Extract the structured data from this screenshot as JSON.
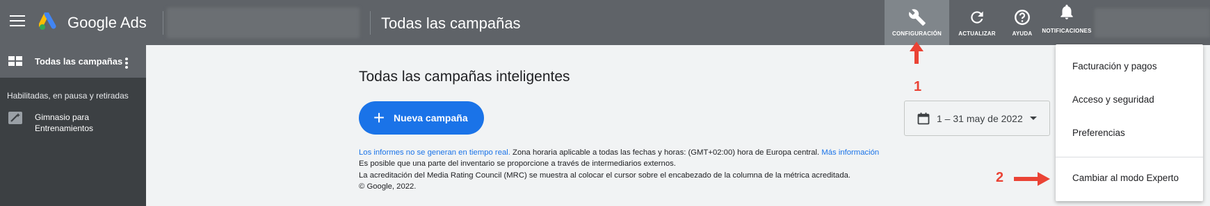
{
  "header": {
    "product_name": "Google Ads",
    "page_title": "Todas las campañas",
    "tools": {
      "configuracion": "CONFIGURACIÓN",
      "actualizar": "ACTUALIZAR",
      "ayuda": "AYUDA",
      "notificaciones": "NOTIFICACIONES"
    }
  },
  "sidebar": {
    "all_campaigns": "Todas las campañas",
    "filter": "Habilitadas, en pausa y retiradas",
    "campaign_name": "Gimnasio para Entrenamientos"
  },
  "main": {
    "title": "Todas las campañas inteligentes",
    "new_campaign": "Nueva campaña",
    "date_range": "1 – 31 may de 2022",
    "notes": {
      "link1": "Los informes no se generan en tiempo real.",
      "line1_rest": " Zona horaria aplicable a todas las fechas y horas: (GMT+02:00) hora de Europa central. ",
      "link2": "Más información",
      "line2": "Es posible que una parte del inventario se proporcione a través de intermediarios externos.",
      "line3": "La acreditación del Media Rating Council (MRC) se muestra al colocar el cursor sobre el encabezado de la columna de la métrica acreditada.",
      "line4": "© Google, 2022."
    }
  },
  "settings_menu": {
    "items": [
      "Facturación y pagos",
      "Acceso y seguridad",
      "Preferencias",
      "Cambiar al modo Experto"
    ]
  },
  "annotations": {
    "step1": "1",
    "step2": "2",
    "color": "#ea4335"
  },
  "colors": {
    "topbar": "#5f6368",
    "sidebar": "#3c4043",
    "accent": "#1a73e8"
  }
}
